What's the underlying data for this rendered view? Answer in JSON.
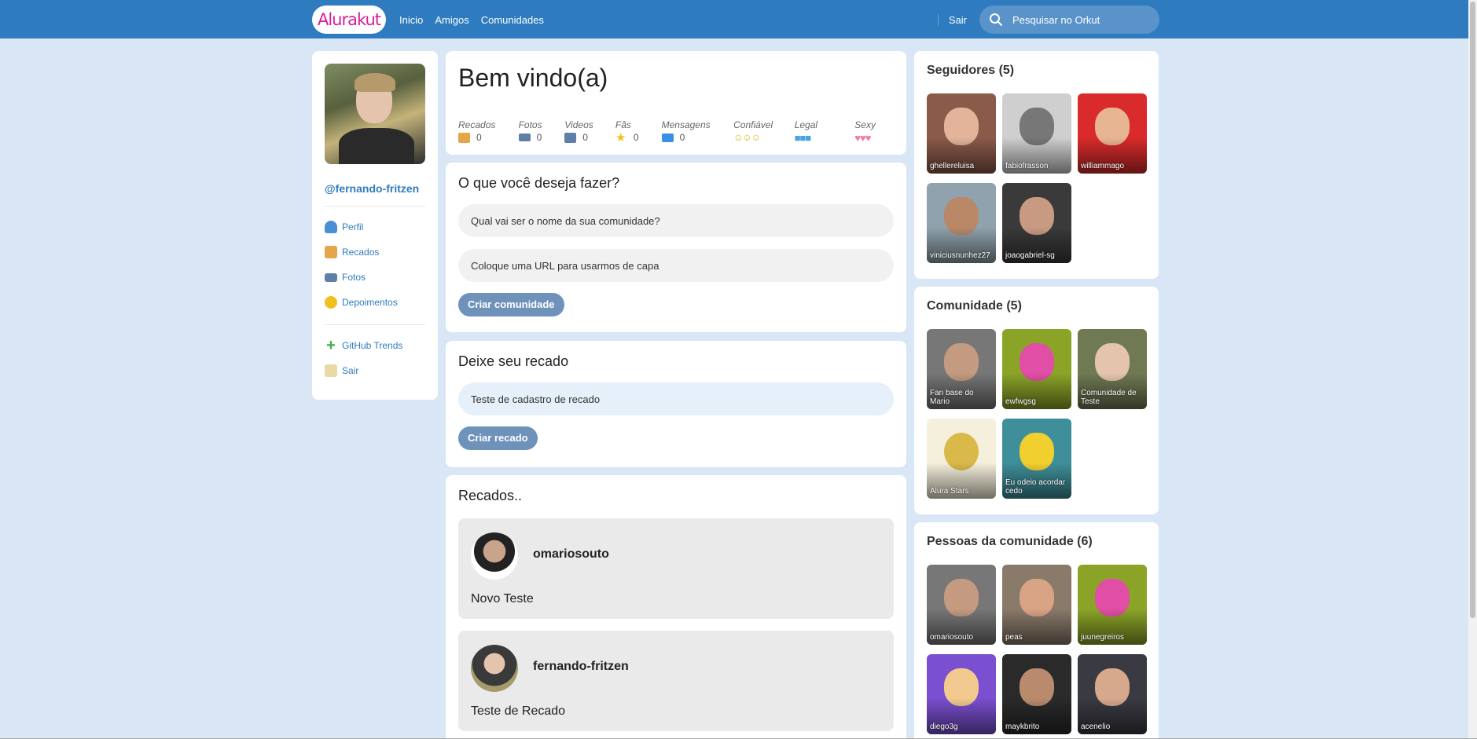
{
  "header": {
    "logo": "Alurakut",
    "nav": [
      "Inicio",
      "Amigos",
      "Comunidades"
    ],
    "logout": "Sair",
    "search_placeholder": "Pesquisar no Orkut"
  },
  "profile": {
    "username": "@fernando-fritzen",
    "menu": [
      {
        "label": "Perfil",
        "icon": "user-icon",
        "color": "#4a8fd6"
      },
      {
        "label": "Recados",
        "icon": "book-icon",
        "color": "#e5a54b"
      },
      {
        "label": "Fotos",
        "icon": "camera-icon",
        "color": "#5d7fa8"
      },
      {
        "label": "Depoimentos",
        "icon": "sun-icon",
        "color": "#f0c020"
      }
    ],
    "menu2": [
      {
        "label": "GitHub Trends",
        "icon": "plus-icon",
        "color": "#3cb043"
      },
      {
        "label": "Sair",
        "icon": "home-icon",
        "color": "#e8d9a6"
      }
    ]
  },
  "welcome": {
    "title": "Bem vindo(a)",
    "stats": [
      {
        "label": "Recados",
        "value": "0",
        "icon": "book-icon",
        "color": "#e5a54b"
      },
      {
        "label": "Fotos",
        "value": "0",
        "icon": "camera-icon",
        "color": "#5d7fa8"
      },
      {
        "label": "Videos",
        "value": "0",
        "icon": "video-icon",
        "color": "#5d7fa8"
      },
      {
        "label": "Fãs",
        "value": "0",
        "icon": "star-icon",
        "color": "#f2c21a"
      },
      {
        "label": "Mensagens",
        "value": "0",
        "icon": "mail-icon",
        "color": "#3a8ee6"
      },
      {
        "label": "Confiável",
        "value": "",
        "icon": "smiley-icon",
        "color": "#f2c21a"
      },
      {
        "label": "Legal",
        "value": "",
        "icon": "cube-icon",
        "color": "#4aa3e0"
      },
      {
        "label": "Sexy",
        "value": "",
        "icon": "heart-icon",
        "color": "#f07aa0"
      }
    ]
  },
  "create_community": {
    "title": "O que você deseja fazer?",
    "name_placeholder": "Qual vai ser o nome da sua comunidade?",
    "url_placeholder": "Coloque uma URL para usarmos de capa",
    "button": "Criar comunidade"
  },
  "create_recado": {
    "title": "Deixe seu recado",
    "input_value": "Teste de cadastro de recado",
    "button": "Criar recado"
  },
  "recados": {
    "title": "Recados..",
    "items": [
      {
        "author": "omariosouto",
        "message": "Novo Teste"
      },
      {
        "author": "fernando-fritzen",
        "message": "Teste de Recado"
      }
    ]
  },
  "followers": {
    "title": "Seguidores (5)",
    "items": [
      "ghellereluisa",
      "fabiofrasson",
      "williammago",
      "viniciusnunhez27",
      "joaogabriel-sg"
    ]
  },
  "communities": {
    "title": "Comunidade (5)",
    "items": [
      "Fan base do Mario",
      "ewfwgsg",
      "Comunidade de Teste",
      "Alura Stars",
      "Eu odeio acordar cedo"
    ]
  },
  "people": {
    "title": "Pessoas da comunidade (6)",
    "items": [
      "omariosouto",
      "peas",
      "juunegreiros",
      "diego3g",
      "maykbrito",
      "acenelio"
    ]
  }
}
